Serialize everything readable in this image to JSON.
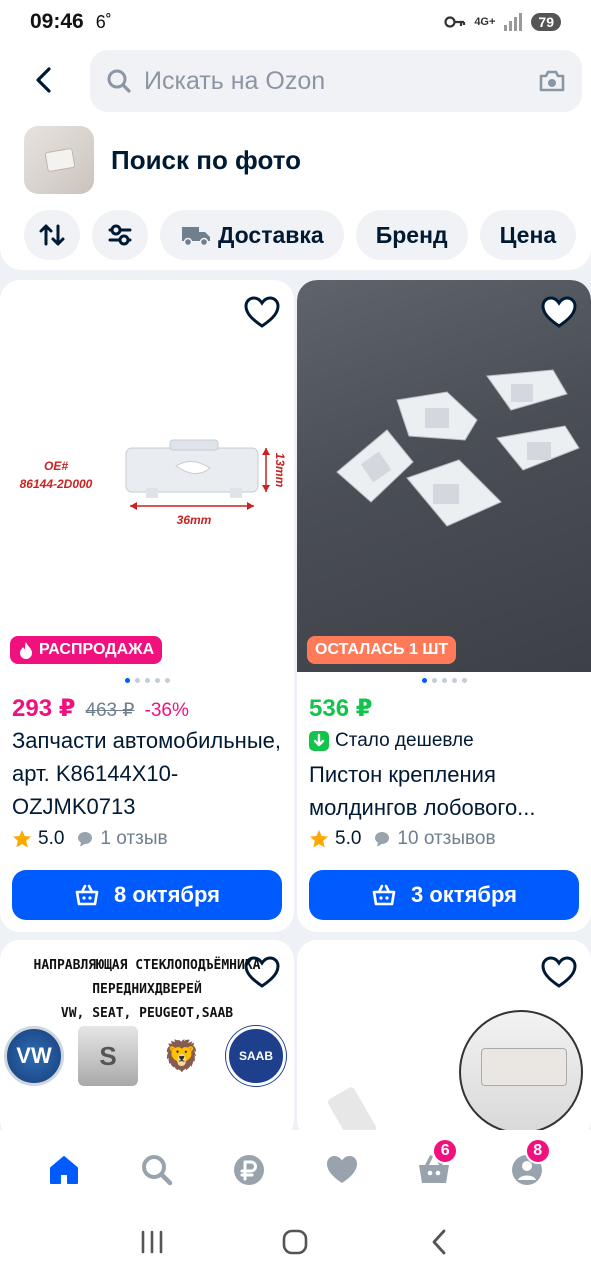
{
  "status_bar": {
    "time": "09:46",
    "temperature": "6˚",
    "network": "4G+",
    "battery": "79"
  },
  "search": {
    "placeholder": "Искать на Ozon"
  },
  "photo_search": {
    "title": "Поиск по фото"
  },
  "filters": [
    "Доставка",
    "Бренд",
    "Цена"
  ],
  "products": [
    {
      "image_text": {
        "oe": "OE#",
        "part": "86144-2D000",
        "width": "36mm",
        "height": "13mm"
      },
      "badge": "РАСПРОДАЖА",
      "price": "293 ₽",
      "old_price": "463 ₽",
      "discount": "-36%",
      "title": "Запчасти автомобильные, арт. K86144X10-OZJMK0713",
      "rating": "5.0",
      "reviews": "1 отзыв",
      "delivery": "8 октября"
    },
    {
      "badge": "ОСТАЛАСЬ 1 ШТ",
      "price": "536 ₽",
      "price_note": "Стало дешевле",
      "title": "Пистон крепления молдингов лобового...",
      "rating": "5.0",
      "reviews": "10 отзывов",
      "delivery": "3 октября"
    }
  ],
  "promo_card": {
    "line1": "НАПРАВЛЯЮЩАЯ СТЕКЛОПОДЪЁМНИКА",
    "line2": "ПЕРЕДНИХДВЕРЕЙ",
    "line3": "VW, SEAT, PEUGEOT,SAAB",
    "logos": [
      "VW",
      "S",
      "🦁",
      "SAAB"
    ]
  },
  "bottom_nav": {
    "cart_count": "6",
    "profile_count": "8"
  },
  "colors": {
    "accent": "#005bff",
    "sale": "#f1117e",
    "green": "#10c44c",
    "orange": "#ff7a59"
  }
}
